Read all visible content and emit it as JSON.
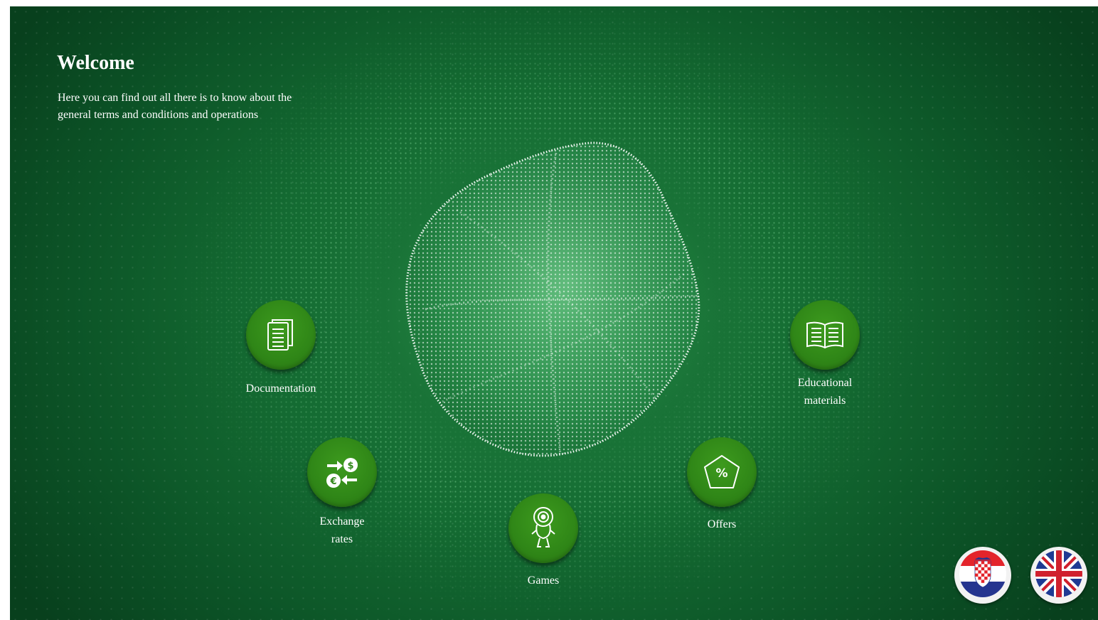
{
  "welcome": {
    "title": "Welcome",
    "text": "Here you can find out all there is to know about the general terms and conditions and operations"
  },
  "nav": {
    "documentation": {
      "label": "Documentation",
      "icon": "document-icon"
    },
    "educational": {
      "label": "Educational materials",
      "icon": "open-book-icon"
    },
    "exchange": {
      "label": "Exchange rates",
      "icon": "currency-exchange-icon"
    },
    "games": {
      "label": "Games",
      "icon": "mascot-icon"
    },
    "offers": {
      "label": "Offers",
      "icon": "percent-badge-icon"
    }
  },
  "languages": [
    {
      "code": "hr",
      "icon": "croatia-flag-icon"
    },
    {
      "code": "en",
      "icon": "uk-flag-icon"
    }
  ],
  "colors": {
    "background": "#146b32",
    "button": "#2f8617",
    "text": "#ffffff"
  }
}
